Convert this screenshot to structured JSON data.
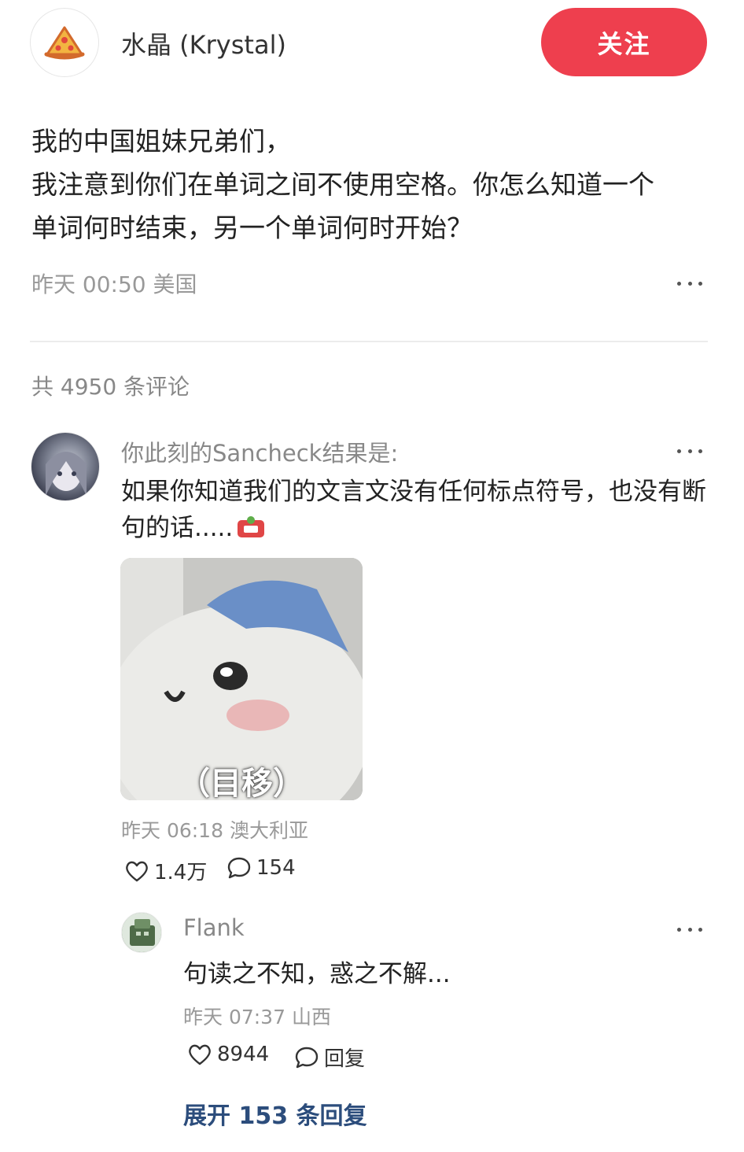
{
  "header": {
    "author_name": "水晶 (Krystal)",
    "avatar_icon": "pizza-slice-icon",
    "follow_label": "关注",
    "accent_color": "#ee3f4e"
  },
  "post": {
    "lines": [
      "我的中国姐妹兄弟们，",
      "我注意到你们在单词之间不使用空格。你怎么知道一个",
      "单词何时结束，另一个单词何时开始？"
    ],
    "meta": "昨天 00:50 美国"
  },
  "comments_header": {
    "count_text": "共 4950 条评论"
  },
  "comment": {
    "user": "你此刻的Sancheck结果是:",
    "text_lines": [
      "如果你知道我们的文言文没有任何标点符号，也没有断",
      "句的话....."
    ],
    "sticker_icon": "red-sticker-icon",
    "image_caption": "（目移）",
    "meta": "昨天 06:18 澳大利亚",
    "likes": "1.4万",
    "replies": "154"
  },
  "reply": {
    "user": "Flank",
    "text": "句读之不知，惑之不解...",
    "meta": "昨天 07:37 山西",
    "likes": "8944",
    "reply_label": "回复"
  },
  "expand": {
    "label": "展开 153 条回复",
    "link_color": "#2c4d7c"
  }
}
